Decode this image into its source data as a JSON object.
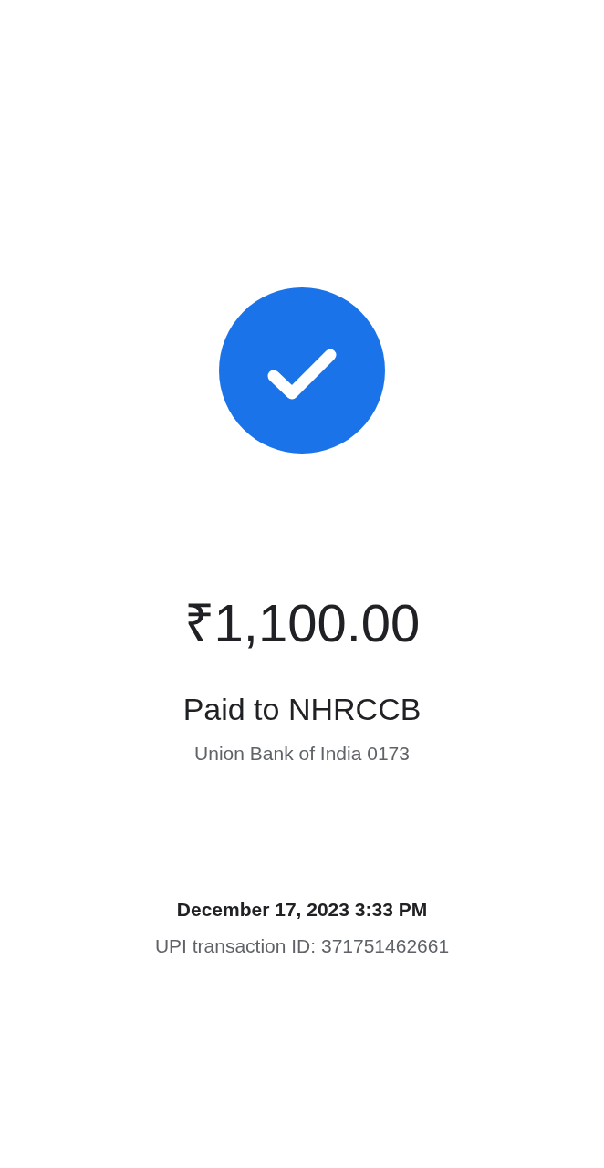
{
  "payment": {
    "amount": "₹1,100.00",
    "payee": "Paid to NHRCCB",
    "account": "Union Bank of India 0173"
  },
  "details": {
    "datetime": "December 17, 2023 3:33 PM",
    "transaction_id": "UPI transaction ID: 371751462661"
  }
}
